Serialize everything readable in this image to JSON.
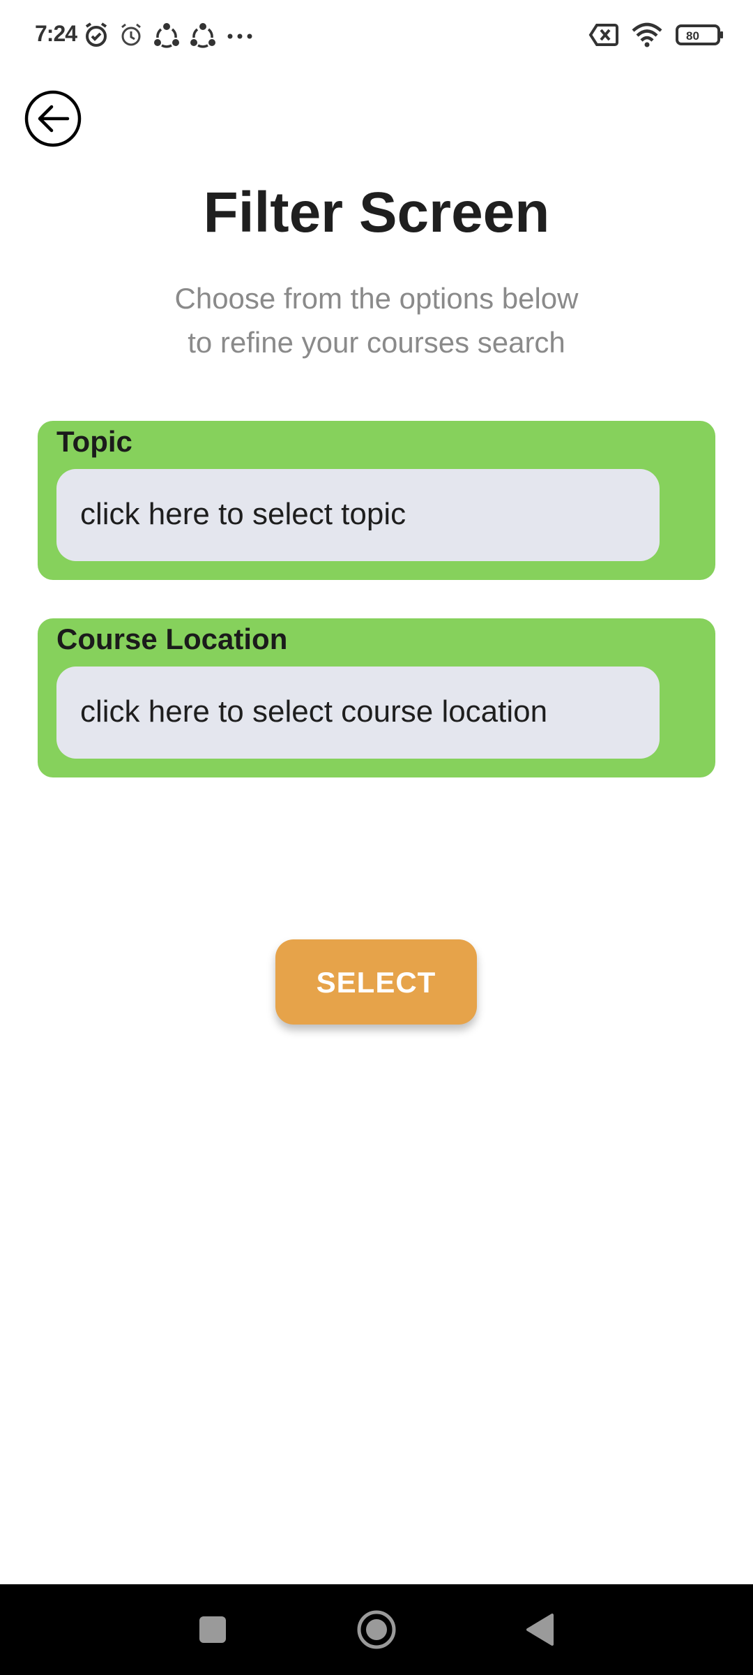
{
  "status_bar": {
    "time": "7:24",
    "battery_level": "80",
    "icons": [
      "alarm-check-icon",
      "alarm-icon",
      "sync-icon",
      "sync-icon",
      "more-dots-icon",
      "no-sim-icon",
      "wifi-icon",
      "battery-icon"
    ]
  },
  "header": {
    "back_icon": "arrow-left-circle-icon",
    "title": "Filter Screen",
    "subtitle_line1": "Choose from the options below",
    "subtitle_line2": "to refine your courses search"
  },
  "filters": [
    {
      "label": "Topic",
      "placeholder": "click here to select topic"
    },
    {
      "label": "Course Location",
      "placeholder": "click here to select course location"
    }
  ],
  "actions": {
    "select_label": "SELECT"
  },
  "nav_bar": {
    "buttons": [
      "recent-apps-icon",
      "home-icon",
      "back-triangle-icon"
    ]
  },
  "colors": {
    "card_green": "#86d15c",
    "field_gray": "#e4e6ee",
    "button_orange": "#e6a34a",
    "subtitle_gray": "#8a8a8a"
  }
}
